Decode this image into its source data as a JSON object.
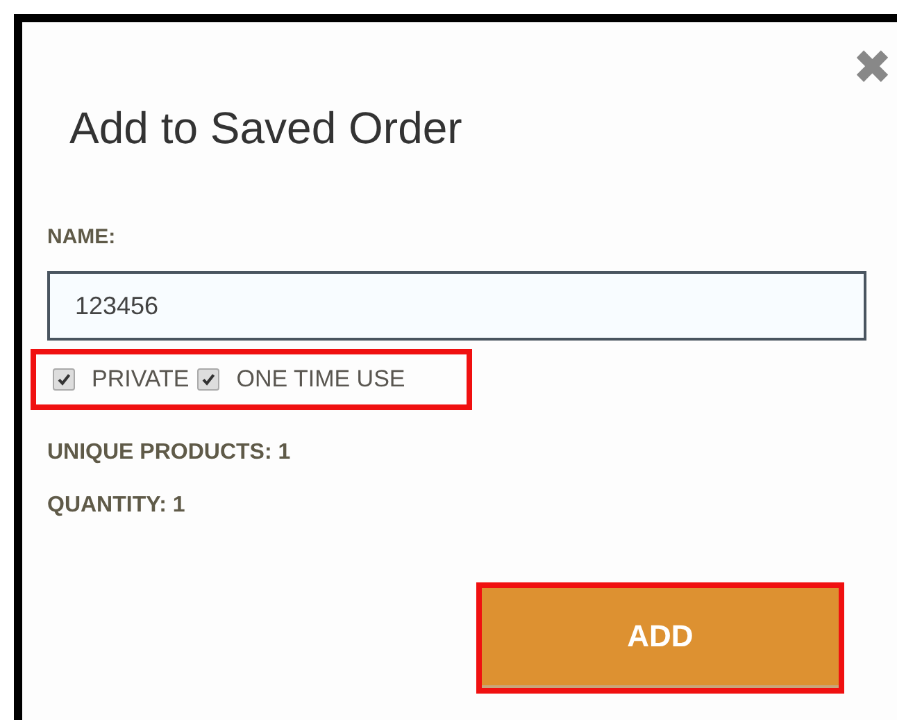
{
  "dialog": {
    "title": "Add to Saved Order",
    "close": "✖"
  },
  "name_field": {
    "label": "NAME:",
    "value": "123456"
  },
  "options": {
    "highlighted": true,
    "items": [
      {
        "label": "PRIVATE",
        "checked": true
      },
      {
        "label": "ONE TIME USE",
        "checked": true
      }
    ]
  },
  "summary": [
    "UNIQUE PRODUCTS: 1",
    "QUANTITY: 1"
  ],
  "add_button": {
    "label": "ADD",
    "highlighted": true
  }
}
